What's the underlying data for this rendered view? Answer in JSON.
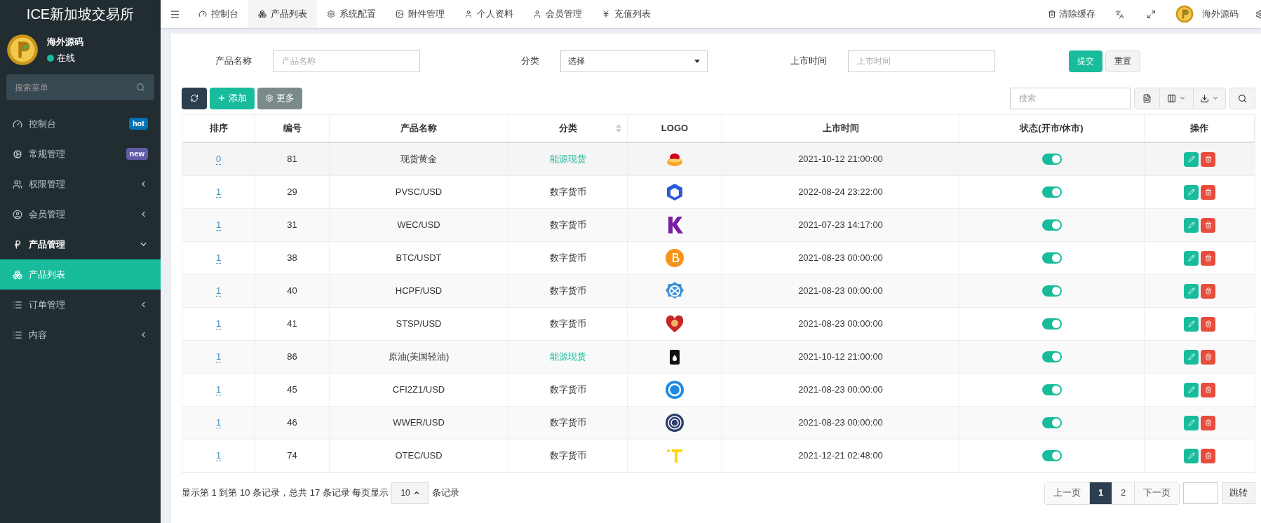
{
  "sidebar": {
    "title": "ICE新加坡交易所",
    "user": {
      "name": "海外源码",
      "status": "在线"
    },
    "search": {
      "placeholder": "搜索菜单"
    },
    "items": [
      {
        "label": "控制台",
        "badge": {
          "text": "hot",
          "color": "#0073b7"
        },
        "selected": false
      },
      {
        "label": "常规管理",
        "badge": {
          "text": "new",
          "color": "#605ca8"
        },
        "selected": false
      },
      {
        "label": "权限管理",
        "expanded": false,
        "selected": false
      },
      {
        "label": "会员管理",
        "expanded": false,
        "selected": false
      },
      {
        "label": "产品管理",
        "expanded": true,
        "selected": false
      },
      {
        "label": "产品列表",
        "selected": true
      },
      {
        "label": "订单管理",
        "expanded": false,
        "selected": false
      },
      {
        "label": "内容",
        "expanded": false,
        "selected": false
      }
    ]
  },
  "topbar": {
    "tabs": [
      {
        "label": "控制台",
        "selected": false
      },
      {
        "label": "产品列表",
        "selected": true
      },
      {
        "label": "系统配置",
        "selected": false
      },
      {
        "label": "附件管理",
        "selected": false
      },
      {
        "label": "个人资料",
        "selected": false
      },
      {
        "label": "会员管理",
        "selected": false
      },
      {
        "label": "充值列表",
        "selected": false
      }
    ],
    "clear_cache": "清除缓存",
    "user": "海外源码"
  },
  "filters": {
    "fields": [
      {
        "label": "产品名称",
        "kind": "text",
        "placeholder": "产品名称"
      },
      {
        "label": "分类",
        "kind": "select",
        "value": "选择"
      },
      {
        "label": "上市时间",
        "kind": "text",
        "placeholder": "上市时间"
      }
    ],
    "submit": "提交",
    "reset": "重置"
  },
  "toolbar": {
    "add": "添加",
    "more": "更多",
    "search": {
      "placeholder": "搜索"
    }
  },
  "table": {
    "columns": [
      "排序",
      "编号",
      "产品名称",
      "分类",
      "LOGO",
      "上市时间",
      "状态(开市/休市)",
      "操作"
    ],
    "rows": [
      {
        "order": "0",
        "id": "81",
        "name": "现货黄金",
        "category": "能源现货",
        "color": "#18bc9c",
        "time": "2021-10-12 21:00:00",
        "on": true
      },
      {
        "order": "1",
        "id": "29",
        "name": "PVSC/USD",
        "category": "数字货币",
        "color": "#333333",
        "time": "2022-08-24 23:22:00",
        "on": true
      },
      {
        "order": "1",
        "id": "31",
        "name": "WEC/USD",
        "category": "数字货币",
        "color": "#333333",
        "time": "2021-07-23 14:17:00",
        "on": true
      },
      {
        "order": "1",
        "id": "38",
        "name": "BTC/USDT",
        "category": "数字货币",
        "color": "#333333",
        "time": "2021-08-23 00:00:00",
        "on": true
      },
      {
        "order": "1",
        "id": "40",
        "name": "HCPF/USD",
        "category": "数字货币",
        "color": "#333333",
        "time": "2021-08-23 00:00:00",
        "on": true
      },
      {
        "order": "1",
        "id": "41",
        "name": "STSP/USD",
        "category": "数字货币",
        "color": "#333333",
        "time": "2021-08-23 00:00:00",
        "on": true
      },
      {
        "order": "1",
        "id": "86",
        "name": "原油(美国轻油)",
        "category": "能源现货",
        "color": "#18bc9c",
        "time": "2021-10-12 21:00:00",
        "on": true
      },
      {
        "order": "1",
        "id": "45",
        "name": "CFI2Z1/USD",
        "category": "数字货币",
        "color": "#333333",
        "time": "2021-08-23 00:00:00",
        "on": true
      },
      {
        "order": "1",
        "id": "46",
        "name": "WWER/USD",
        "category": "数字货币",
        "color": "#333333",
        "time": "2021-08-23 00:00:00",
        "on": true
      },
      {
        "order": "1",
        "id": "74",
        "name": "OTEC/USD",
        "category": "数字货币",
        "color": "#333333",
        "time": "2021-12-21 02:48:00",
        "on": true
      }
    ]
  },
  "footer": {
    "summary_before": "显示第 1 到第 10 条记录，总共 17 条记录 每页显示",
    "page_size": "10",
    "summary_after": "条记录",
    "pagination": {
      "prev": "上一页",
      "pages": [
        {
          "label": "1",
          "selected": true
        },
        {
          "label": "2",
          "selected": false
        }
      ],
      "next": "下一页",
      "jump": "跳转"
    }
  }
}
